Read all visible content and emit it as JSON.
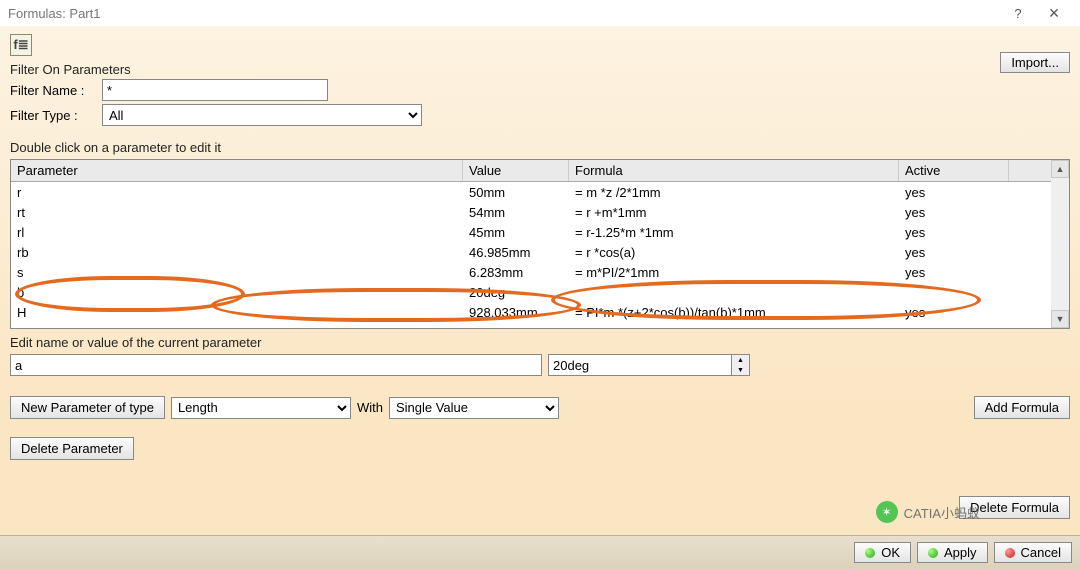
{
  "window": {
    "title": "Formulas: Part1",
    "help_glyph": "?",
    "close_glyph": "×"
  },
  "toolbar": {
    "fx_icon_label": "f≣",
    "import_label": "Import..."
  },
  "filters": {
    "section_label": "Filter On Parameters",
    "name_label": "Filter Name :",
    "name_value": "*",
    "type_label": "Filter Type : ",
    "type_value": "All"
  },
  "table": {
    "instruction": "Double click on a parameter to edit it",
    "headers": {
      "parameter": "Parameter",
      "value": "Value",
      "formula": "Formula",
      "active": "Active"
    },
    "rows": [
      {
        "param": "r",
        "value": "50mm",
        "formula": "= m *z /2*1mm",
        "active": "yes"
      },
      {
        "param": "rt",
        "value": "54mm",
        "formula": "= r +m*1mm",
        "active": "yes"
      },
      {
        "param": "rl",
        "value": "45mm",
        "formula": "= r-1.25*m *1mm",
        "active": "yes"
      },
      {
        "param": "rb",
        "value": "46.985mm",
        "formula": "= r *cos(a)",
        "active": "yes"
      },
      {
        "param": "s",
        "value": "6.283mm",
        "formula": "= m*PI/2*1mm",
        "active": "yes"
      },
      {
        "param": "b",
        "value": "20deg",
        "formula": "",
        "active": ""
      },
      {
        "param": "H",
        "value": "928.033mm",
        "formula": "= PI*m *(z+2*cos(b))/tan(b)*1mm",
        "active": "yes"
      }
    ]
  },
  "edit": {
    "label": "Edit name or value of the current parameter",
    "param_name": "a",
    "param_value": "20deg"
  },
  "new_param": {
    "button_label": "New Parameter of type",
    "type_value": "Length",
    "with_label": "With",
    "with_value": "Single Value",
    "add_formula_label": "Add Formula"
  },
  "bottom": {
    "delete_param_label": "Delete Parameter",
    "delete_formula_label": "Delete Formula"
  },
  "footer": {
    "ok": "OK",
    "apply": "Apply",
    "cancel": "Cancel"
  },
  "watermark": "CATIA小蚂蚁",
  "annotation_colors": {
    "highlight": "#e36a1e"
  }
}
